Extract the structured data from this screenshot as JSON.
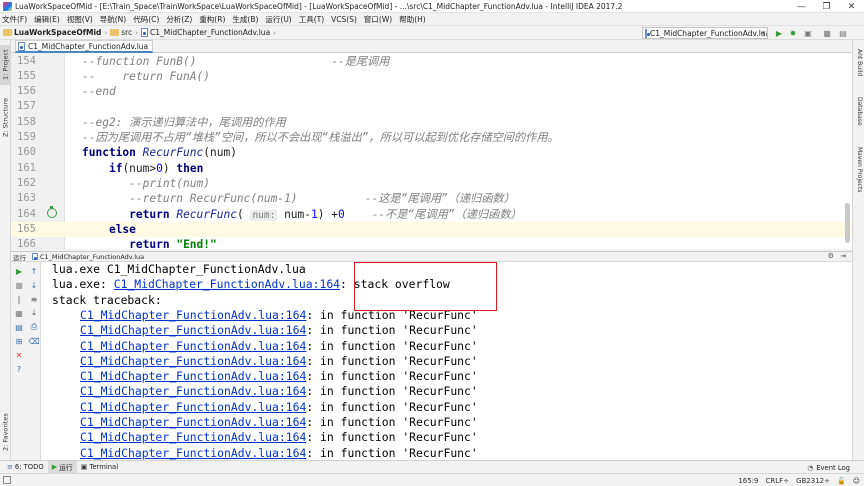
{
  "window": {
    "title": "LuaWorkSpaceOfMid - [E:\\Train_Space\\TrainWorkSpace\\LuaWorkSpaceOfMid] - [LuaWorkSpaceOfMid] - ...\\src\\C1_MidChapter_FunctionAdv.lua - IntelliJ IDEA 2017.2",
    "minimize": "—",
    "maximize": "❐",
    "close": "✕"
  },
  "menu": [
    "文件(F)",
    "编辑(E)",
    "视图(V)",
    "导航(N)",
    "代码(C)",
    "分析(Z)",
    "重构(R)",
    "生成(B)",
    "运行(U)",
    "工具(T)",
    "VCS(S)",
    "窗口(W)",
    "帮助(H)"
  ],
  "breadcrumb": {
    "project": "LuaWorkSpaceOfMid",
    "folder": "src",
    "file": "C1_MidChapter_FunctionAdv.lua"
  },
  "run_config": "C1_MidChapter_FunctionAdv.lua",
  "editor_tab": "C1_MidChapter_FunctionAdv.lua",
  "left_tabs": [
    "1: Project",
    "Z: Structure",
    "2: Favorites"
  ],
  "right_tabs": [
    "Ant Build",
    "Database",
    "Maven Projects"
  ],
  "code_lines": [
    {
      "n": "154",
      "html": "<span class=\"cmt\">--function FunB()                    --是尾调用</span>"
    },
    {
      "n": "155",
      "html": "<span class=\"cmt\">--    return FunA()</span>"
    },
    {
      "n": "156",
      "html": "<span class=\"cmt\">--end</span>"
    },
    {
      "n": "157",
      "html": ""
    },
    {
      "n": "158",
      "html": "<span class=\"cmt\">--eg2: 演示递归算法中，尾调用的作用</span>"
    },
    {
      "n": "159",
      "html": "<span class=\"cmt\">--因为尾调用不占用“堆栈”空间，所以不会出现“栈溢出”，所以可以起到优化存储空间的作用。</span>"
    },
    {
      "n": "160",
      "html": "<span class=\"kw\">function</span> <span class=\"fn\">RecurFunc</span>(num)"
    },
    {
      "n": "161",
      "html": "    <span class=\"kw\">if</span>(num><span class=\"num\">0</span>) <span class=\"kw\">then</span>"
    },
    {
      "n": "162",
      "html": "       <span class=\"cmt\">--print(num)</span>"
    },
    {
      "n": "163",
      "html": "       <span class=\"cmt\">--return RecurFunc(num-1)          --这是“尾调用”（递归函数）</span>"
    },
    {
      "n": "164",
      "html": "       <span class=\"kw\">return</span> <span class=\"fn\">RecurFunc</span>( <span class=\"hint\">num:</span> num-<span class=\"num\">1</span>) +<span class=\"num\">0</span>    <span class=\"cmt\">--不是“尾调用”（递归函数）</span>"
    },
    {
      "n": "165",
      "html": "    <span class=\"kw\">else</span>",
      "current": true
    },
    {
      "n": "166",
      "html": "       <span class=\"kw\">return</span> <span class=\"str\">\"End!\"</span>"
    }
  ],
  "run_panel": {
    "label": "运行",
    "config": "C1_MidChapter_FunctionAdv.lua"
  },
  "console": {
    "line1": "lua.exe C1_MidChapter_FunctionAdv.lua",
    "line2_prefix": "lua.exe: ",
    "line2_link": "C1_MidChapter_FunctionAdv.lua:164",
    "line2_suffix": ": stack overflow",
    "line3": "stack traceback:",
    "trace_link": "C1_MidChapter_FunctionAdv.lua:164",
    "trace_suffix": ": in function 'RecurFunc'",
    "trace_count": 10
  },
  "bottom_tabs": {
    "todo": "6: TODO",
    "run": "运行",
    "terminal": "Terminal",
    "event_log": "Event Log"
  },
  "status": {
    "position": "165:9",
    "line_sep": "CRLF÷",
    "encoding": "GB2312÷"
  }
}
